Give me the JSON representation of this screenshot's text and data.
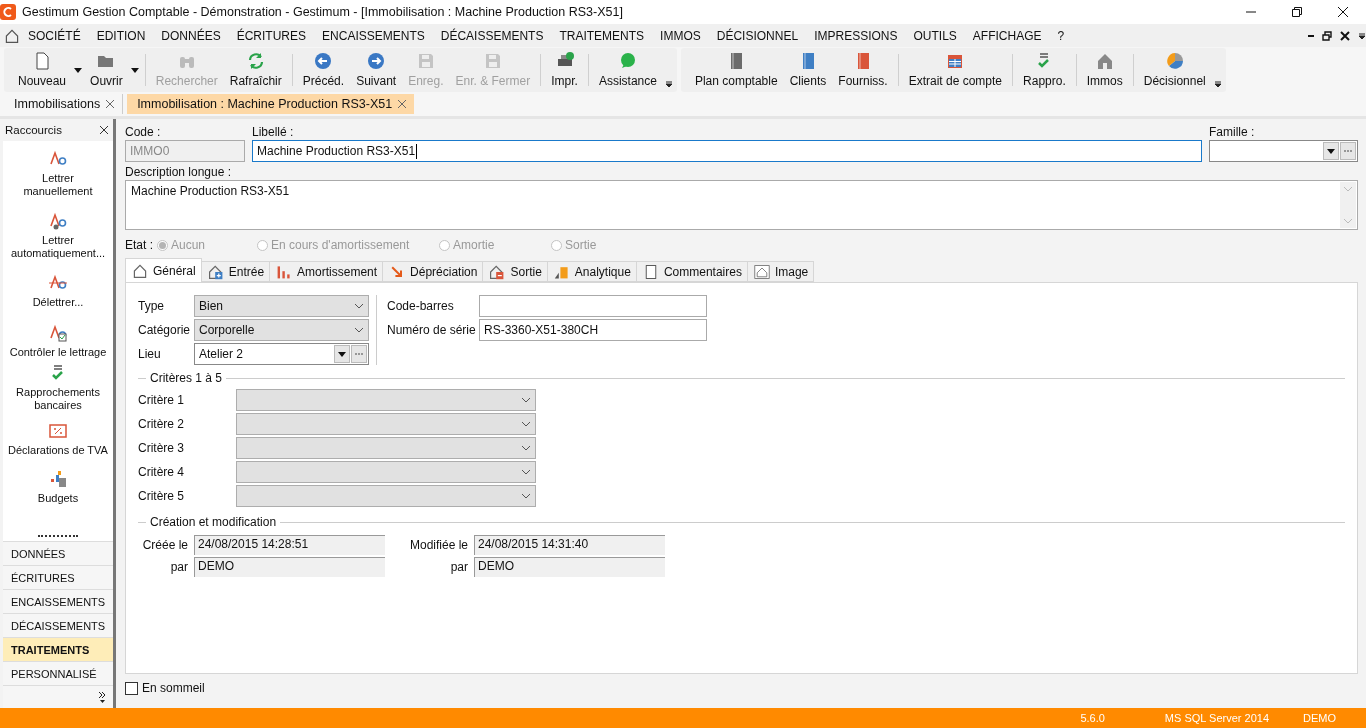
{
  "window": {
    "title": "Gestimum Gestion Comptable - Démonstration - Gestimum - [Immobilisation : Machine Production RS3-X51]"
  },
  "menu": [
    "SOCIÉTÉ",
    "EDITION",
    "DONNÉES",
    "ÉCRITURES",
    "ENCAISSEMENTS",
    "DÉCAISSEMENTS",
    "TRAITEMENTS",
    "IMMOS",
    "DÉCISIONNEL",
    "IMPRESSIONS",
    "OUTILS",
    "AFFICHAGE",
    "?"
  ],
  "toolbars": [
    {
      "groups": [
        [
          {
            "label": "Nouveau",
            "kind": "page",
            "disabled": false,
            "dropdown": true
          },
          {
            "label": "Ouvrir",
            "kind": "folder",
            "disabled": false,
            "dropdown": true
          }
        ],
        [
          {
            "label": "Rechercher",
            "kind": "binoculars",
            "disabled": true,
            "dropdown": false
          },
          {
            "label": "Rafraîchir",
            "kind": "refresh",
            "disabled": false,
            "dropdown": false
          }
        ],
        [
          {
            "label": "Précéd.",
            "kind": "left",
            "disabled": false,
            "dropdown": false
          },
          {
            "label": "Suivant",
            "kind": "right",
            "disabled": false,
            "dropdown": false
          },
          {
            "label": "Enreg.",
            "kind": "floppy",
            "disabled": true,
            "dropdown": false
          },
          {
            "label": "Enr. & Fermer",
            "kind": "floppy",
            "disabled": true,
            "dropdown": false
          }
        ],
        [
          {
            "label": "Impr.",
            "kind": "printer",
            "disabled": false,
            "dropdown": false
          }
        ],
        [
          {
            "label": "Assistance",
            "kind": "chat",
            "disabled": false,
            "dropdown": false
          }
        ]
      ]
    },
    {
      "groups": [
        [
          {
            "label": "Plan comptable",
            "kind": "book",
            "color": "#6b6b6b",
            "disabled": false,
            "dropdown": false
          },
          {
            "label": "Clients",
            "kind": "book",
            "color": "#3f7fc4",
            "disabled": false,
            "dropdown": false
          },
          {
            "label": "Fourniss.",
            "kind": "book",
            "color": "#d9553a",
            "disabled": false,
            "dropdown": false
          }
        ],
        [
          {
            "label": "Extrait de compte",
            "kind": "calendar",
            "disabled": false,
            "dropdown": false
          }
        ],
        [
          {
            "label": "Rappro.",
            "kind": "check",
            "disabled": false,
            "dropdown": false
          }
        ],
        [
          {
            "label": "Immos",
            "kind": "house",
            "disabled": false,
            "dropdown": false
          }
        ],
        [
          {
            "label": "Décisionnel",
            "kind": "pie",
            "disabled": false,
            "dropdown": false
          }
        ]
      ]
    }
  ],
  "doc_tabs": [
    {
      "label": "Immobilisations",
      "selected": false
    },
    {
      "label": "Immobilisation : Machine Production RS3-X51",
      "selected": true
    }
  ],
  "sidebar": {
    "title": "Raccourcis",
    "shortcuts": [
      {
        "label": "Lettrer manuellement",
        "kind": "letter"
      },
      {
        "label": "Lettrer automatiquement...",
        "kind": "letter-gear"
      },
      {
        "label": "Délettrer...",
        "kind": "letter-strike"
      },
      {
        "label": "Contrôler le lettrage",
        "kind": "letter-check"
      },
      {
        "label": "Rapprochements bancaires",
        "kind": "check"
      },
      {
        "label": "Déclarations de TVA",
        "kind": "percent"
      },
      {
        "label": "Budgets",
        "kind": "budget"
      }
    ],
    "sections": [
      {
        "label": "DONNÉES",
        "selected": false
      },
      {
        "label": "ÉCRITURES",
        "selected": false
      },
      {
        "label": "ENCAISSEMENTS",
        "selected": false
      },
      {
        "label": "DÉCAISSEMENTS",
        "selected": false
      },
      {
        "label": "TRAITEMENTS",
        "selected": true
      },
      {
        "label": "PERSONNALISÉ",
        "selected": false
      }
    ]
  },
  "form": {
    "code": {
      "label": "Code :",
      "value": "IMMO0",
      "disabled": true
    },
    "libelle": {
      "label": "Libellé :",
      "value": "Machine Production RS3-X51"
    },
    "famille": {
      "label": "Famille :"
    },
    "description": {
      "label": "Description longue :",
      "value": "Machine Production RS3-X51"
    },
    "etat": {
      "label": "Etat :",
      "disabled": true,
      "options": [
        {
          "label": "Aucun",
          "selected": true
        },
        {
          "label": "En cours d'amortissement",
          "selected": false
        },
        {
          "label": "Amortie",
          "selected": false
        },
        {
          "label": "Sortie",
          "selected": false
        }
      ]
    },
    "tabs": [
      {
        "label": "Général",
        "kind": "house",
        "selected": true
      },
      {
        "label": "Entrée",
        "kind": "house-plus",
        "selected": false
      },
      {
        "label": "Amortissement",
        "kind": "bars",
        "selected": false
      },
      {
        "label": "Dépréciation",
        "kind": "arrow-down",
        "selected": false
      },
      {
        "label": "Sortie",
        "kind": "house-minus",
        "selected": false
      },
      {
        "label": "Analytique",
        "kind": "analytic",
        "selected": false
      },
      {
        "label": "Commentaires",
        "kind": "note",
        "selected": false
      },
      {
        "label": "Image",
        "kind": "image",
        "selected": false
      }
    ],
    "general": {
      "type": {
        "label": "Type",
        "value": "Bien"
      },
      "categorie": {
        "label": "Catégorie",
        "value": "Corporelle"
      },
      "lieu": {
        "label": "Lieu",
        "value": "Atelier 2"
      },
      "code_barres": {
        "label": "Code-barres"
      },
      "numero_serie": {
        "label": "Numéro de série",
        "value": "RS-3360-X51-380CH"
      },
      "criteres": {
        "title": "Critères 1 à 5",
        "items": [
          {
            "label": "Critère 1"
          },
          {
            "label": "Critère 2"
          },
          {
            "label": "Critère 3"
          },
          {
            "label": "Critère 4"
          },
          {
            "label": "Critère 5"
          }
        ]
      },
      "creation": {
        "title": "Création et modification",
        "fields": [
          {
            "label": "Créée le",
            "value": "24/08/2015 14:28:51"
          },
          {
            "label": "Modifiée le",
            "value": "24/08/2015 14:31:40"
          },
          {
            "label": "par",
            "value": "DEMO"
          },
          {
            "label": "par",
            "value": "DEMO"
          }
        ]
      }
    },
    "en_sommeil": {
      "label": "En sommeil",
      "checked": false
    }
  },
  "status_bar": [
    "5.6.0",
    "MS SQL Server 2014",
    "DEMO"
  ]
}
